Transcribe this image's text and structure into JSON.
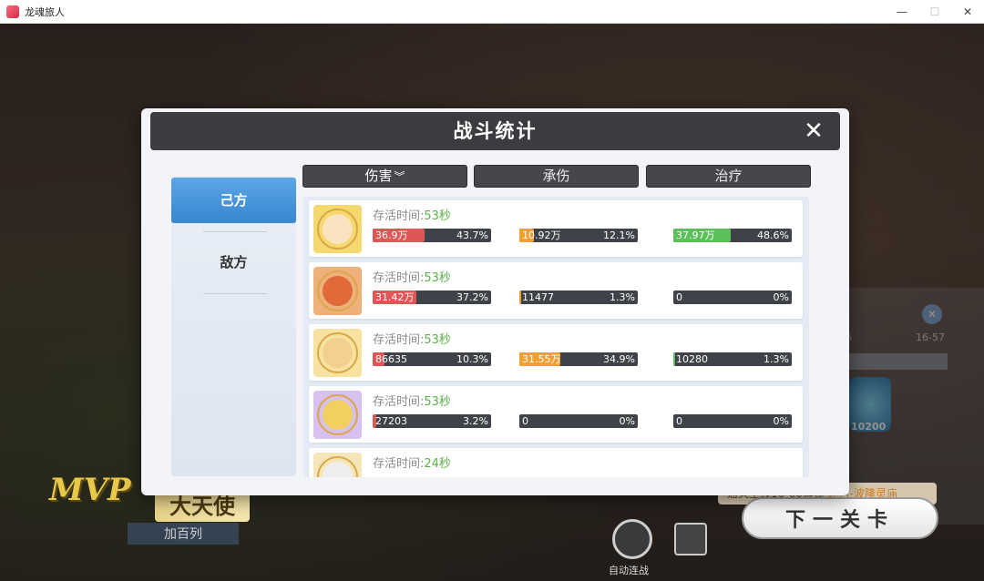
{
  "window": {
    "title": "龙魂旅人",
    "controls": [
      "—",
      "☐",
      "✕"
    ]
  },
  "background": {
    "mvp_badge": "MVP",
    "mvp_title": "大天使",
    "mvp_name": "加百列",
    "next_button": "下一关卡",
    "auto_label": "自动连战",
    "unlock_prefix": "通关主线16-60解锁",
    "unlock_highlight": "迷宫-波隆灵庙",
    "reward_count": "10200",
    "range_left": "6",
    "range_right": "16-57"
  },
  "dialog": {
    "title": "战斗统计",
    "close_icon": "✕",
    "side_tabs": [
      {
        "label": "己方",
        "active": true
      },
      {
        "label": "敌方",
        "active": false
      }
    ],
    "columns": [
      {
        "label": "伤害",
        "sort_icon": "︾",
        "active": true
      },
      {
        "label": "承伤",
        "active": false
      },
      {
        "label": "治疗",
        "active": false
      }
    ],
    "survive_label": "存活时间:",
    "rows": [
      {
        "avatar_color": "#f5d86e",
        "face": "#fbe3c0",
        "time": "53秒",
        "damage": {
          "value": "36.9万",
          "pct": "43.7%",
          "frac": 0.437
        },
        "taken": {
          "value": "10.92万",
          "pct": "12.1%",
          "frac": 0.121
        },
        "heal": {
          "value": "37.97万",
          "pct": "48.6%",
          "frac": 0.486
        }
      },
      {
        "avatar_color": "#f0b07a",
        "face": "#e06a3a",
        "time": "53秒",
        "damage": {
          "value": "31.42万",
          "pct": "37.2%",
          "frac": 0.372
        },
        "taken": {
          "value": "11477",
          "pct": "1.3%",
          "frac": 0.013
        },
        "heal": {
          "value": "0",
          "pct": "0%",
          "frac": 0
        }
      },
      {
        "avatar_color": "#f7e2a0",
        "face": "#f3d090",
        "time": "53秒",
        "damage": {
          "value": "86635",
          "pct": "10.3%",
          "frac": 0.103
        },
        "taken": {
          "value": "31.55万",
          "pct": "34.9%",
          "frac": 0.349
        },
        "heal": {
          "value": "10280",
          "pct": "1.3%",
          "frac": 0.013
        }
      },
      {
        "avatar_color": "#d8c0f0",
        "face": "#f2d060",
        "time": "53秒",
        "damage": {
          "value": "27203",
          "pct": "3.2%",
          "frac": 0.032
        },
        "taken": {
          "value": "0",
          "pct": "0%",
          "frac": 0
        },
        "heal": {
          "value": "0",
          "pct": "0%",
          "frac": 0
        }
      },
      {
        "avatar_color": "#f5e6b8",
        "face": "#eeeeee",
        "time": "24秒",
        "damage": {
          "value": "",
          "pct": "",
          "frac": 0
        },
        "taken": {
          "value": "",
          "pct": "",
          "frac": 0
        },
        "heal": {
          "value": "",
          "pct": "",
          "frac": 0
        }
      }
    ]
  }
}
